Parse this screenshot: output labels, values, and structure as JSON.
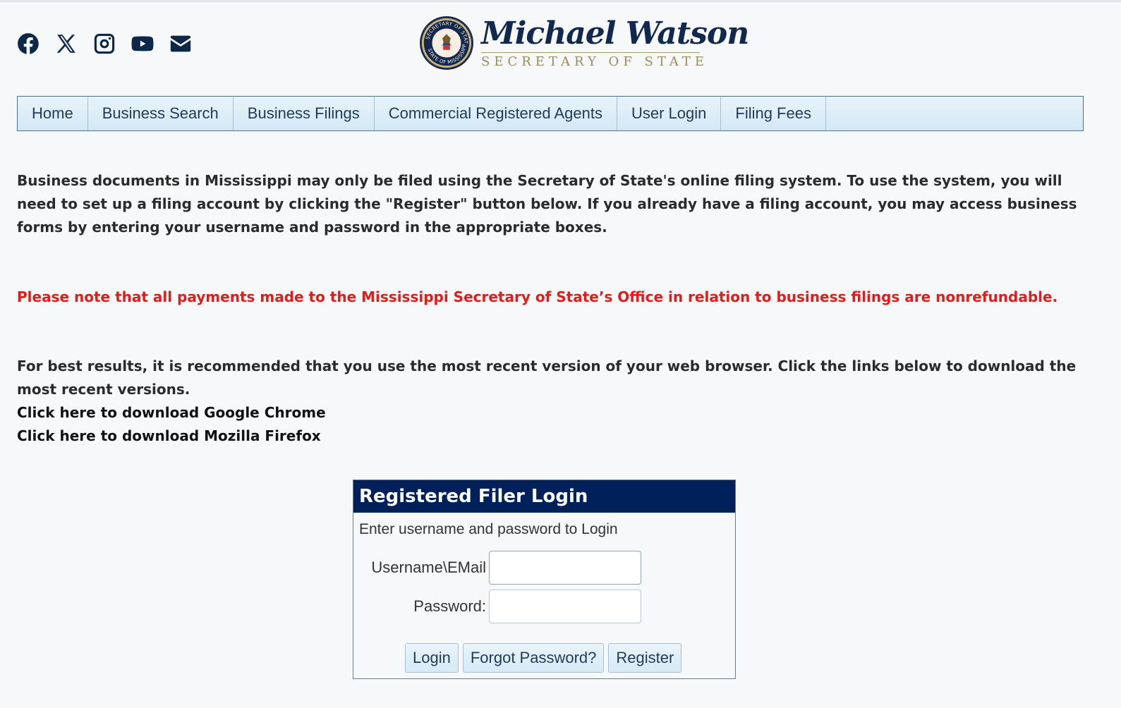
{
  "header": {
    "social_icons": [
      "facebook-icon",
      "x-icon",
      "instagram-icon",
      "youtube-icon",
      "email-icon"
    ],
    "brand_name": "Michael Watson",
    "brand_subtitle": "SECRETARY OF STATE",
    "seal_text_top": "SECRETARY OF STATE",
    "seal_text_bottom": "STATE OF MISSISSIPPI"
  },
  "nav": {
    "items": [
      "Home",
      "Business Search",
      "Business Filings",
      "Commercial Registered Agents",
      "User Login",
      "Filing Fees"
    ]
  },
  "content": {
    "intro": "Business documents in Mississippi may only be filed using the Secretary of State's online filing system. To use the system, you will need to set up a filing account by clicking the \"Register\" button below. If you already have a filing account, you may access business forms by entering your username and password in the appropriate boxes.",
    "warning": "Please note that all payments made to the Mississippi Secretary of State’s Office in relation to business filings are nonrefundable.",
    "browser_note": "For best results, it is recommended that you use the most recent version of your web browser. Click the links below to download the most recent versions.",
    "chrome_link": "Click here to download Google Chrome",
    "firefox_link": "Click here to download Mozilla Firefox"
  },
  "login": {
    "title": "Registered Filer Login",
    "subtitle": "Enter username and password to Login",
    "username_label": "Username\\EMail",
    "username_value": "",
    "password_label": "Password:",
    "password_value": "",
    "login_button": "Login",
    "forgot_button": "Forgot Password?",
    "register_button": "Register"
  },
  "colors": {
    "navy": "#00205b",
    "warning_red": "#e21b1b",
    "brand_gold": "#9c8a58"
  }
}
